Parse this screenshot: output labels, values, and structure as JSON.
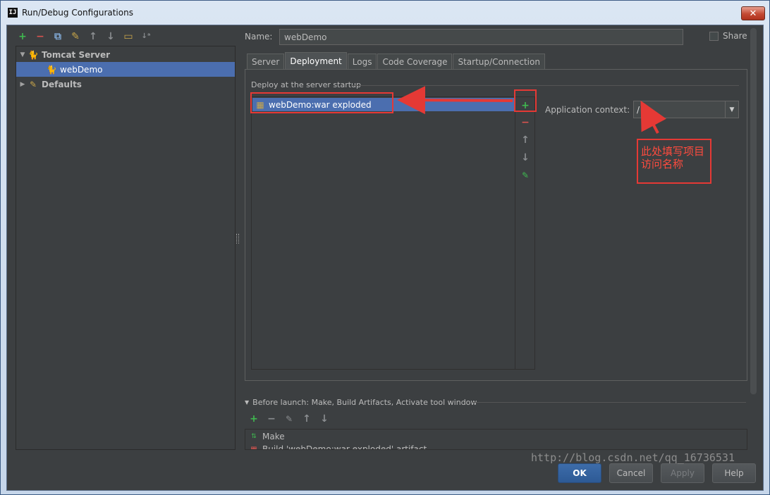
{
  "window": {
    "title": "Run/Debug Configurations",
    "app_icon": "IJ",
    "close_label": "✕"
  },
  "toolbar_icons": [
    "add-icon",
    "remove-icon",
    "copy-icon",
    "wrench-icon",
    "arrow-up-icon",
    "arrow-down-icon",
    "folder-icon",
    "sort-icon"
  ],
  "tree": {
    "items": [
      {
        "label": "Tomcat Server",
        "icon": "tomcat-icon",
        "expanded": true
      },
      {
        "label": "webDemo",
        "icon": "tomcat-icon",
        "selected": true
      },
      {
        "label": "Defaults",
        "icon": "wrench-icon",
        "expanded": false
      }
    ]
  },
  "name": {
    "label": "Name:",
    "value": "webDemo"
  },
  "share": {
    "label": "Share",
    "checked": false
  },
  "tabs": [
    {
      "label": "Server",
      "active": false
    },
    {
      "label": "Deployment",
      "active": true
    },
    {
      "label": "Logs",
      "active": false
    },
    {
      "label": "Code Coverage",
      "active": false
    },
    {
      "label": "Startup/Connection",
      "active": false
    }
  ],
  "deployment": {
    "section_label": "Deploy at the server startup",
    "items": [
      "webDemo:war exploded"
    ],
    "context_label": "Application context:",
    "context_value": "/"
  },
  "annotation": {
    "line1": "此处填写项目",
    "line2": "访问名称",
    "color": "#e53935"
  },
  "before_launch": {
    "header": "Before launch: Make, Build Artifacts, Activate tool window",
    "items": [
      "Make",
      "Build 'webDemo:war exploded' artifact"
    ]
  },
  "buttons": {
    "ok": "OK",
    "cancel": "Cancel",
    "apply": "Apply",
    "help": "Help"
  },
  "watermark": "http://blog.csdn.net/qq_16736531"
}
